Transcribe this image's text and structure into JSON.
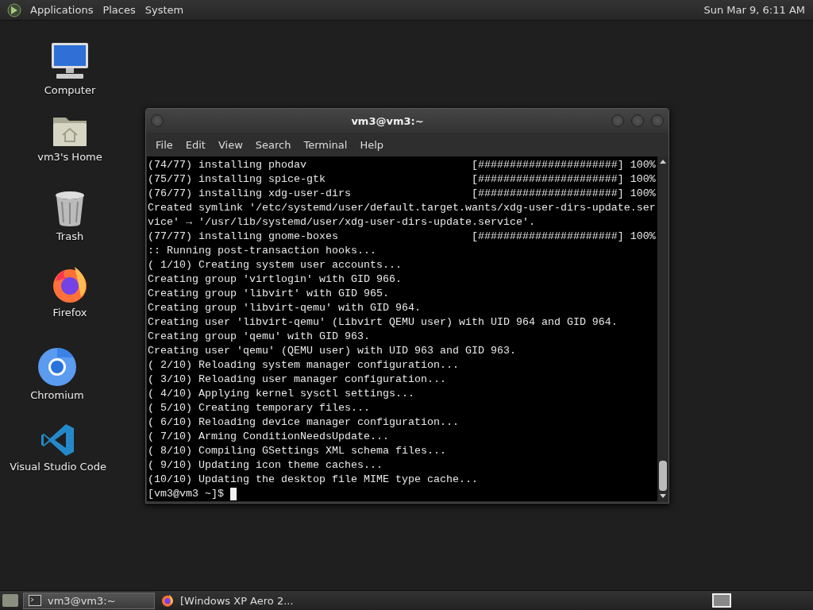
{
  "top_panel": {
    "menus": [
      "Applications",
      "Places",
      "System"
    ],
    "clock": "Sun Mar 9, 6:11 AM"
  },
  "desktop_icons": [
    {
      "label": "Computer",
      "kind": "computer"
    },
    {
      "label": "vm3's Home",
      "kind": "home"
    },
    {
      "label": "Trash",
      "kind": "trash"
    },
    {
      "label": "Firefox",
      "kind": "firefox"
    },
    {
      "label": "Chromium",
      "kind": "chromium"
    },
    {
      "label": "Visual Studio Code",
      "kind": "vscode"
    }
  ],
  "terminal": {
    "title": "vm3@vm3:~",
    "menu": [
      "File",
      "Edit",
      "View",
      "Search",
      "Terminal",
      "Help"
    ],
    "lines": [
      "(74/77) installing phodav                          [######################] 100%",
      "(75/77) installing spice-gtk                       [######################] 100%",
      "(76/77) installing xdg-user-dirs                   [######################] 100%",
      "Created symlink '/etc/systemd/user/default.target.wants/xdg-user-dirs-update.ser",
      "vice' → '/usr/lib/systemd/user/xdg-user-dirs-update.service'.",
      "(77/77) installing gnome-boxes                     [######################] 100%",
      ":: Running post-transaction hooks...",
      "( 1/10) Creating system user accounts...",
      "Creating group 'virtlogin' with GID 966.",
      "Creating group 'libvirt' with GID 965.",
      "Creating group 'libvirt-qemu' with GID 964.",
      "Creating user 'libvirt-qemu' (Libvirt QEMU user) with UID 964 and GID 964.",
      "Creating group 'qemu' with GID 963.",
      "Creating user 'qemu' (QEMU user) with UID 963 and GID 963.",
      "( 2/10) Reloading system manager configuration...",
      "( 3/10) Reloading user manager configuration...",
      "( 4/10) Applying kernel sysctl settings...",
      "( 5/10) Creating temporary files...",
      "( 6/10) Reloading device manager configuration...",
      "( 7/10) Arming ConditionNeedsUpdate...",
      "( 8/10) Compiling GSettings XML schema files...",
      "( 9/10) Updating icon theme caches...",
      "(10/10) Updating the desktop file MIME type cache..."
    ],
    "prompt": "[vm3@vm3 ~]$ "
  },
  "taskbar": {
    "tasks": [
      {
        "label": "vm3@vm3:~",
        "kind": "terminal",
        "selected": true
      },
      {
        "label": "[Windows XP Aero 2...",
        "kind": "firefox",
        "selected": false
      }
    ]
  }
}
